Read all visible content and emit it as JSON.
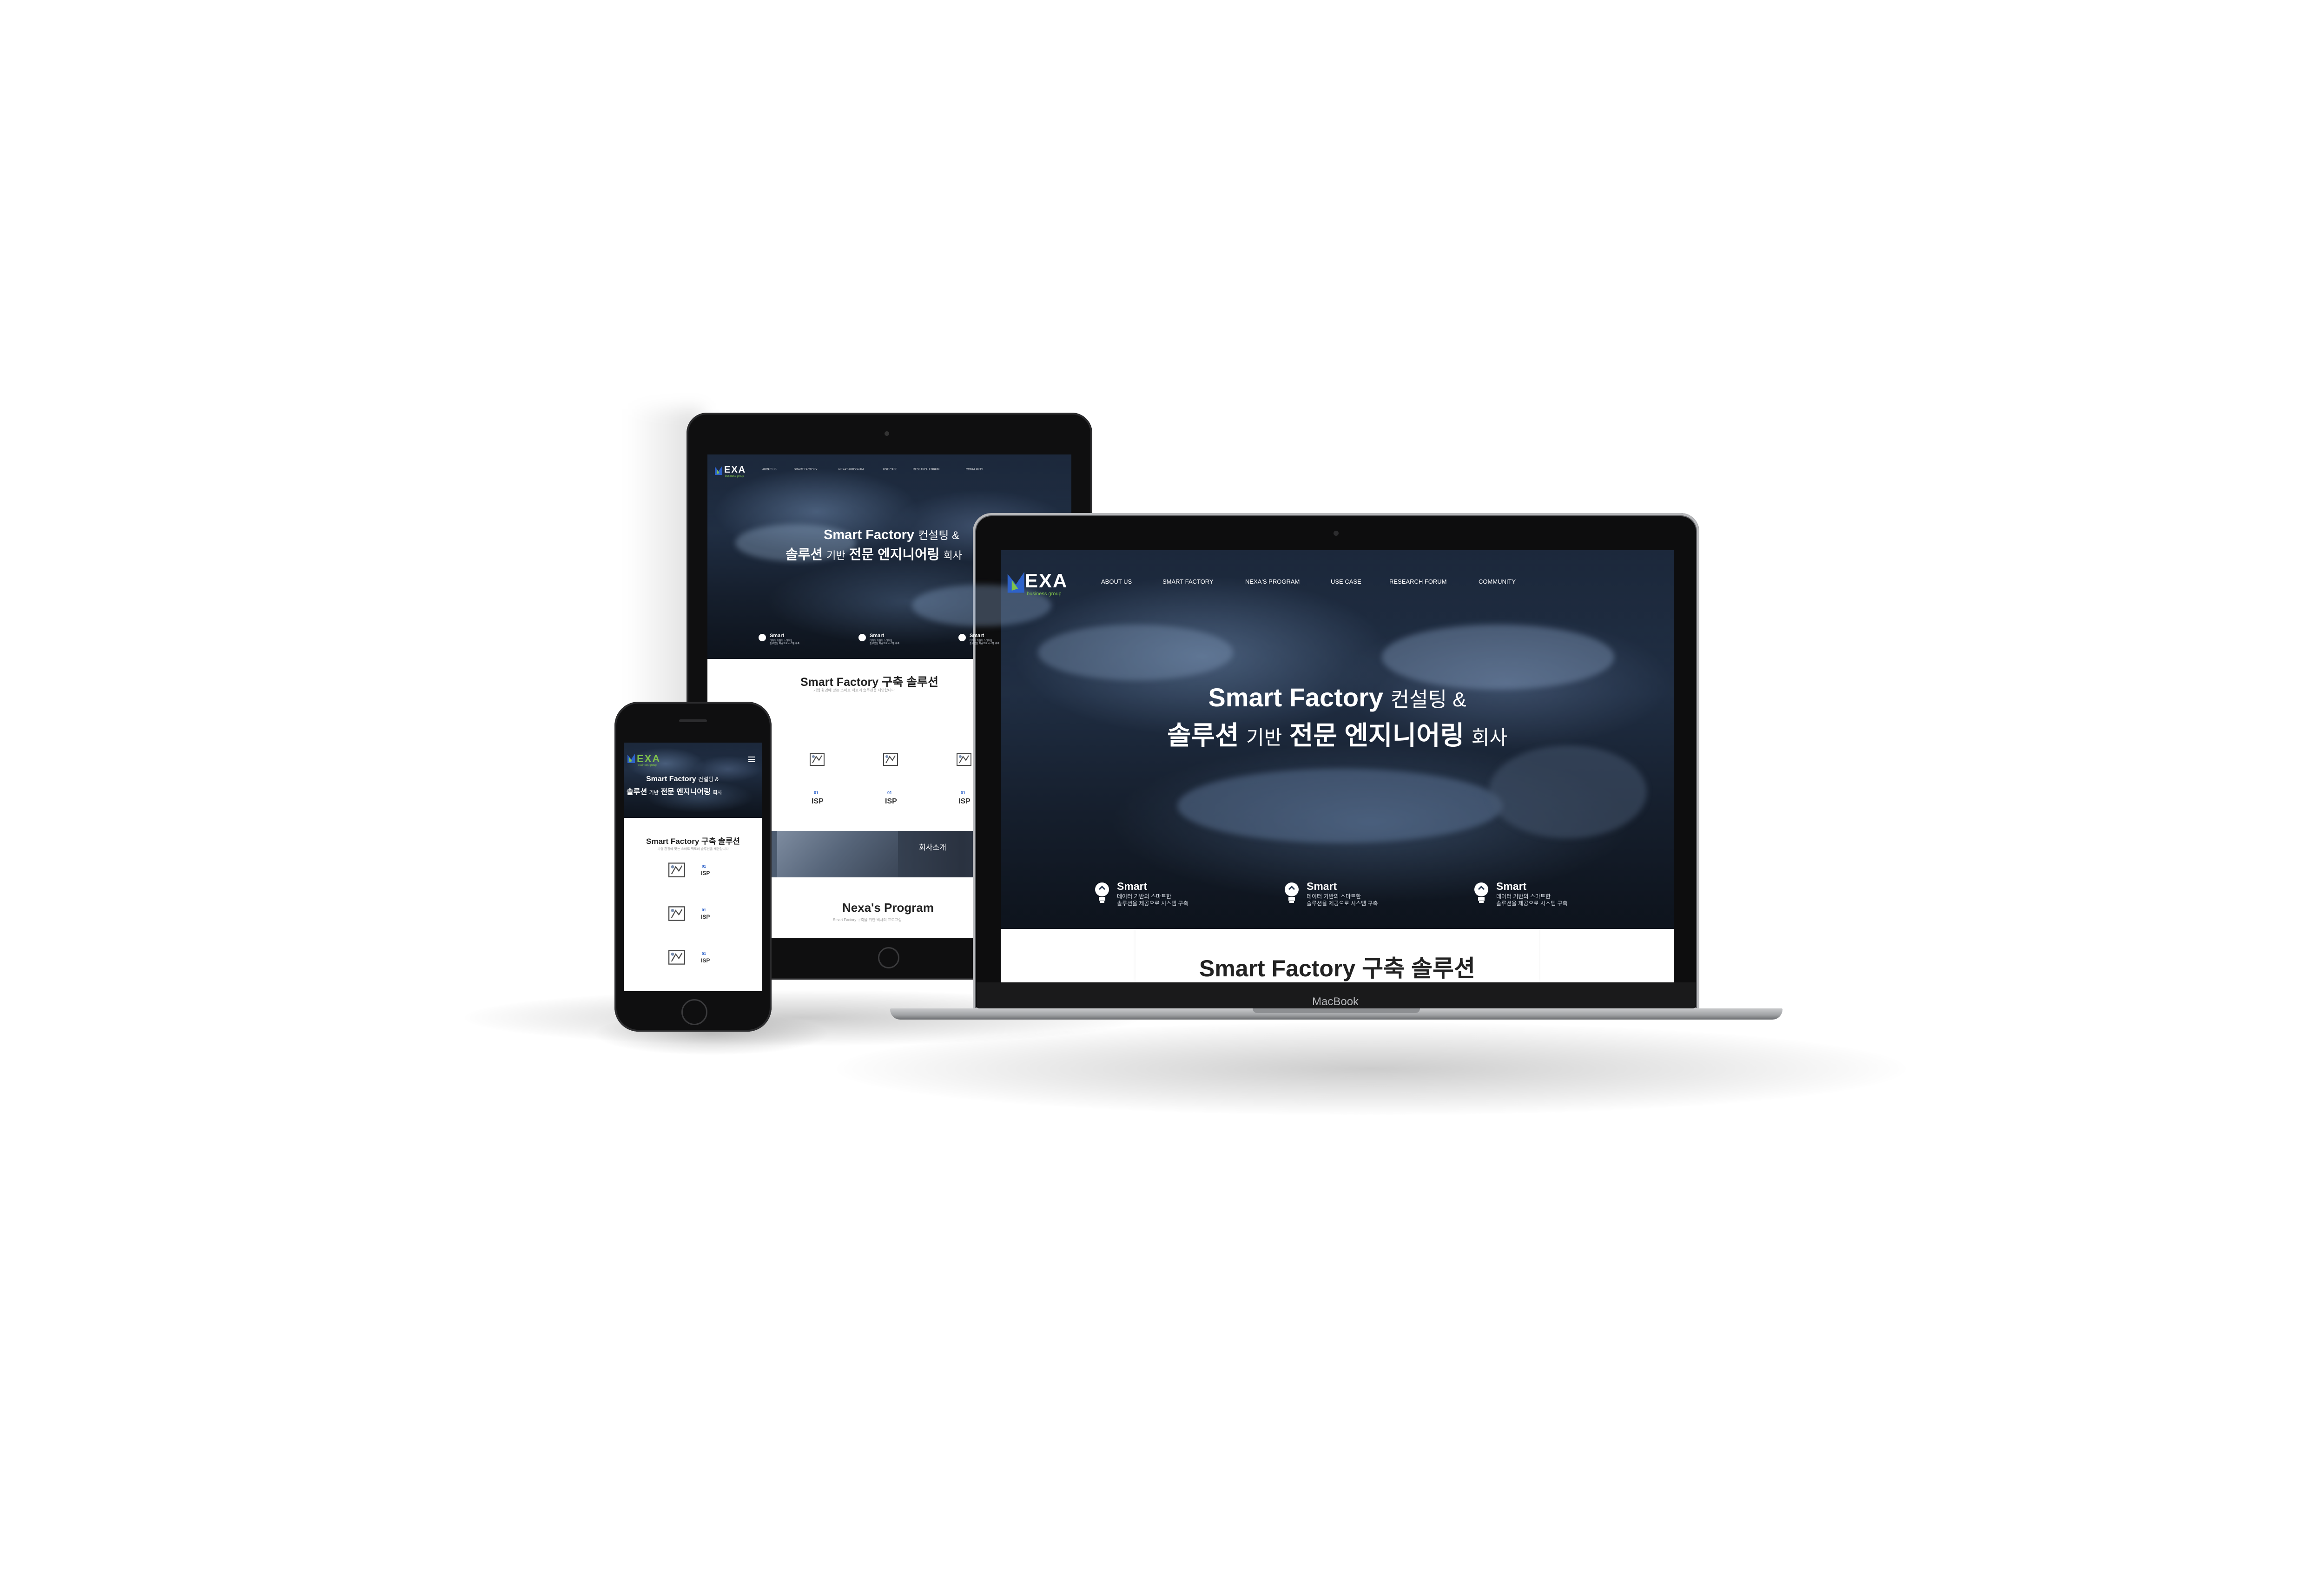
{
  "brand": {
    "logo_text": "EXA",
    "logo_sub": "business group",
    "accent": "#7fc24a",
    "accent2": "#2e62c9"
  },
  "nav": {
    "items": [
      "ABOUT US",
      "SMART FACTORY",
      "NEXA'S PROGRAM",
      "USE CASE",
      "RESEARCH FORUM",
      "COMMUNITY"
    ]
  },
  "hero": {
    "line1_bold": "Smart Factory",
    "line1_light": "컨설팅 &",
    "line2_a": "솔루션",
    "line2_b": "기반",
    "line2_c": "전문 엔지니어링",
    "line2_d": "회사"
  },
  "features": [
    {
      "title": "Smart",
      "desc1": "데이터 기반의 스마트한",
      "desc2": "솔루션을 제공으로 시스템 구축",
      "icon": "bulb-icon"
    },
    {
      "title": "Smart",
      "desc1": "데이터 기반의 스마트한",
      "desc2": "솔루션을 제공으로 시스템 구축",
      "icon": "bulb-icon"
    },
    {
      "title": "Smart",
      "desc1": "데이터 기반의 스마트한",
      "desc2": "솔루션을 제공으로 시스템 구축",
      "icon": "bulb-icon"
    }
  ],
  "solutions": {
    "title": "Smart Factory 구축 솔루션",
    "subtitle": "기업 환경에 맞는 스마트 팩토리 솔루션을 제안합니다",
    "items": [
      {
        "num": "01",
        "label": "ISP",
        "icon": "blueprint-icon"
      },
      {
        "num": "01",
        "label": "ISP",
        "icon": "blueprint-icon"
      },
      {
        "num": "01",
        "label": "ISP",
        "icon": "blueprint-icon"
      }
    ]
  },
  "about_banner": {
    "label": "회사소개"
  },
  "program": {
    "title": "Nexa's Program",
    "subtitle": "Smart Factory 구축을 위한 넥사의 프로그램"
  },
  "device": {
    "laptop_label": "MacBook"
  }
}
